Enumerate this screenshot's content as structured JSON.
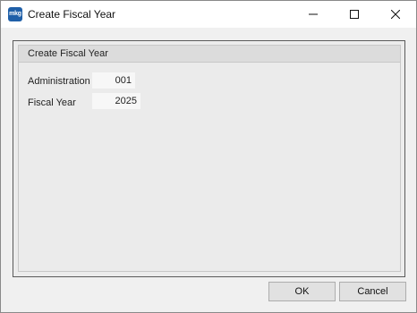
{
  "window": {
    "title": "Create Fiscal Year",
    "app_icon_text": "mkg",
    "controls": {
      "minimize": "minimize-icon",
      "maximize": "maximize-icon",
      "close": "close-icon"
    }
  },
  "form": {
    "group_title": "Create Fiscal Year",
    "fields": [
      {
        "label": "Administration",
        "value": "001"
      },
      {
        "label": "Fiscal Year",
        "value": "2025"
      }
    ]
  },
  "buttons": {
    "ok": "OK",
    "cancel": "Cancel"
  },
  "colors": {
    "app_icon_bg": "#1f5fa8",
    "dialog_bg": "#f0f0f0",
    "group_header_bg": "#dcdcdc"
  }
}
